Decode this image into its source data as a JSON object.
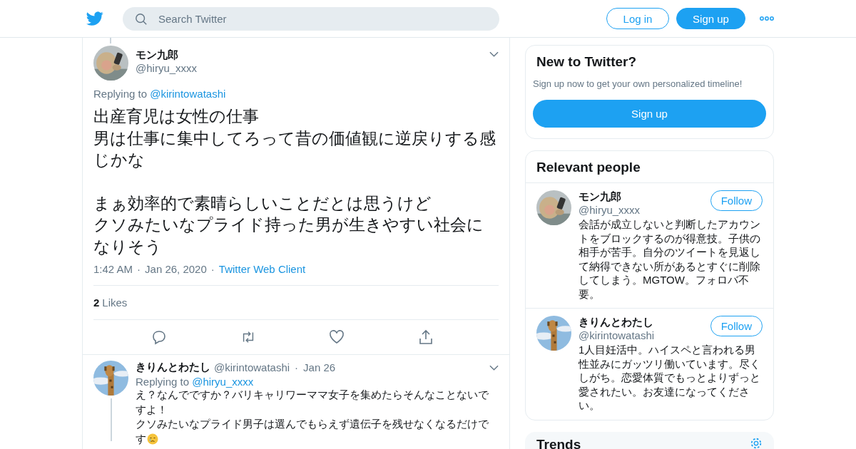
{
  "header": {
    "search": {
      "placeholder": "Search Twitter"
    },
    "buttons": [
      {
        "label": "Log in",
        "kind": "outline"
      },
      {
        "label": "Sign up",
        "kind": "filled"
      }
    ]
  },
  "main_tweet": {
    "name": "モン九郎",
    "handle": "@hiryu_xxxx",
    "replying_label": "Replying to",
    "reply_to": "@kirintowatashi",
    "paragraphs": [
      [
        "出産育児は女性の仕事",
        "男は仕事に集中してろって昔の価値観に逆戻りする感じかな"
      ],
      [
        "まぁ効率的で素晴らしいことだとは思うけど",
        "クソみたいなプライド持った男が生きやすい社会になりそう"
      ]
    ],
    "time": "1:42 AM",
    "separators": [
      "·",
      "·"
    ],
    "date": "Jan 26, 2020",
    "client": "Twitter Web Client",
    "likes_count": "2",
    "likes_label": "Likes"
  },
  "replies": [
    {
      "name": "きりんとわたし",
      "handle": "@kirintowatashi",
      "separator": "·",
      "date": "Jan 26",
      "replying_label": "Replying to",
      "reply_to": "@hiryu_xxxx",
      "lines": [
        "え？なんでですか？バリキャリワーママ女子を集めたらそんなことないで",
        "すよ！",
        "クソみたいなプライド男子は選んでもらえず遺伝子を残せなくなるだけで",
        "す"
      ]
    }
  ],
  "sidebar": {
    "signup_card": {
      "title": "New to Twitter?",
      "subtitle": "Sign up now to get your own personalized timeline!",
      "button": "Sign up"
    },
    "people_card": {
      "title": "Relevant people",
      "people": [
        {
          "name": "モン九郎",
          "handle": "@hiryu_xxxx",
          "button": "Follow",
          "bio": "会話が成立しないと判断したアカウントをブロックするのが得意技。子供の相手が苦手。自分のツイートを見返して納得できない所があるとすぐに削除してしまう。MGTOW。フォロバ不要。"
        },
        {
          "name": "きりんとわたし",
          "handle": "@kirintowatashi",
          "button": "Follow",
          "bio": "1人目妊活中。ハイスペと言われる男性並みにガッツリ働いています。尽くしがち。恋愛体質でもっとよりずっと愛されたい。お友達になってください。"
        }
      ]
    },
    "trends_card": {
      "title": "Trends"
    }
  }
}
